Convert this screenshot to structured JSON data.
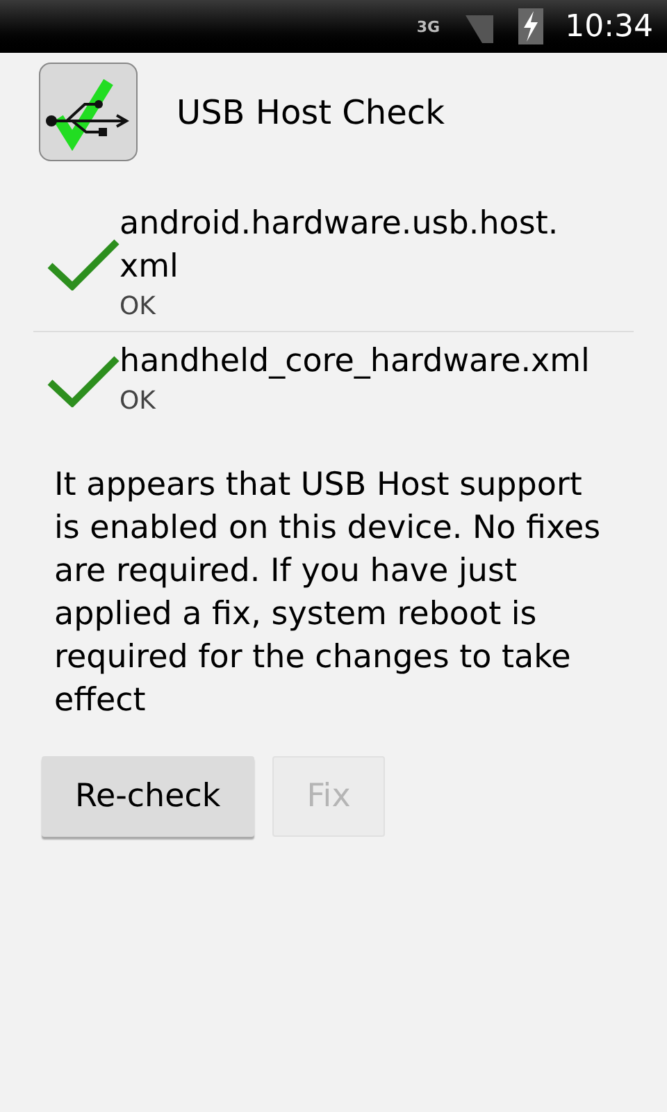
{
  "status_bar": {
    "network": "3G",
    "time": "10:34"
  },
  "app": {
    "title": "USB Host Check"
  },
  "checks": [
    {
      "name": "android.hardware.usb.host.\nxml",
      "result": "OK",
      "passed": true
    },
    {
      "name": "handheld_core_hardware.xml",
      "result": "OK",
      "passed": true
    }
  ],
  "message": "It appears that USB Host support is enabled on this device. No fixes are required. If you have just applied a fix, system reboot is required for the changes to take effect",
  "buttons": [
    {
      "label": "Re-check",
      "disabled": false
    },
    {
      "label": "Fix",
      "disabled": true
    }
  ]
}
